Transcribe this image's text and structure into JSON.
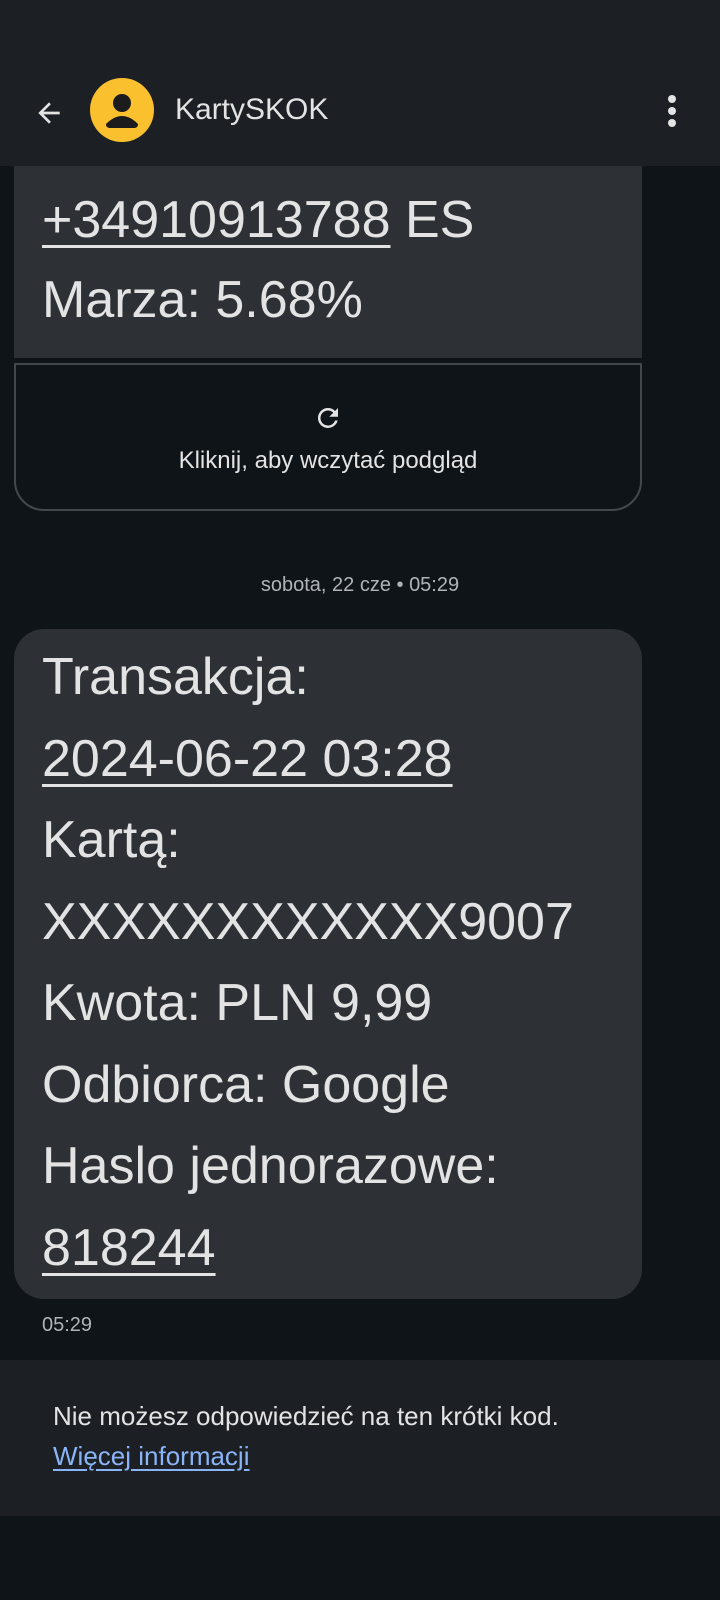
{
  "header": {
    "title": "KartySKOK",
    "back_icon": "arrow-back-icon",
    "avatar_icon": "person-icon",
    "menu_icon": "more-vert-icon",
    "avatar_color": "#fbc02d"
  },
  "messages": {
    "previous": {
      "lines": [
        "+34910913788 ES",
        "Marza: 5.68%"
      ],
      "preview_label": "Kliknij, aby wczytać podgląd",
      "preview_icon": "refresh-icon"
    },
    "date_separator": "sobota, 22 cze • 05:29",
    "current": {
      "lines": [
        "Transakcja:",
        "2024-06-22 03:28",
        "Kartą:",
        "XXXXXXXXXXXX9007",
        "Kwota: PLN 9,99",
        "Odbiorca: Google",
        "Haslo jednorazowe:",
        "818244"
      ],
      "time": "05:29"
    }
  },
  "notice": {
    "text": "Nie możesz odpowiedzieć na ten krótki kod.",
    "link": "Więcej informacji"
  },
  "colors": {
    "background": "#0f1418",
    "bar": "#1c2024",
    "bubble": "#2d3135",
    "link": "#8ab4f8"
  }
}
